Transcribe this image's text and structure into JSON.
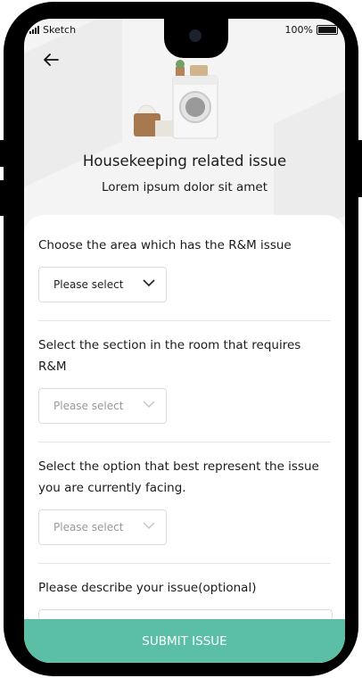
{
  "status_bar": {
    "carrier": "Sketch",
    "battery": "100%"
  },
  "header": {
    "back_icon": "arrow-left-icon",
    "illustration": "washing-machine-illustration",
    "title": "Housekeeping related issue",
    "subtitle": "Lorem ipsum dolor sit amet"
  },
  "form": {
    "q1": {
      "label": "Choose the area which has the R&M issue",
      "select": "Please select"
    },
    "q2": {
      "label": "Select the section in the room that requires R&M",
      "select": "Please select"
    },
    "q3": {
      "label": "Select the option that best represent the issue you are currently facing.",
      "select": "Please select"
    },
    "q4": {
      "label": "Please describe your issue(optional)"
    }
  },
  "submit_label": "SUBMIT ISSUE",
  "colors": {
    "accent": "#5bbfa5",
    "screen_bg": "#f4f4f4"
  }
}
